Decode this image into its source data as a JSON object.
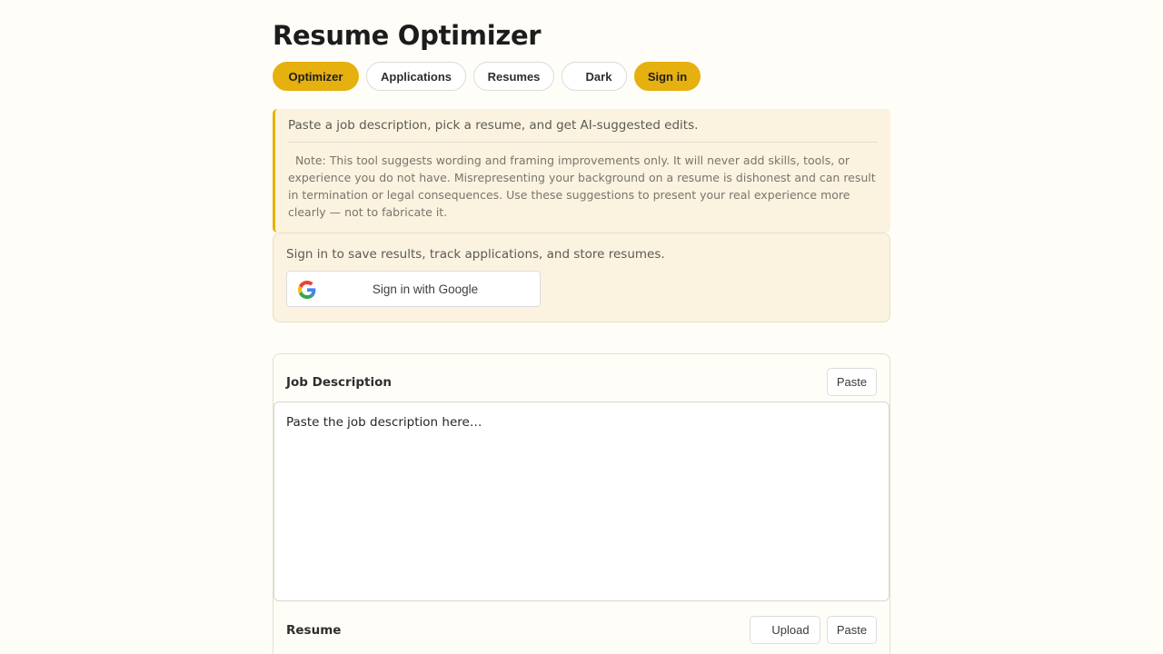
{
  "page": {
    "title": "Resume Optimizer"
  },
  "nav": {
    "optimizer": "Optimizer",
    "applications": "Applications",
    "resumes": "Resumes",
    "dark": "Dark",
    "sign_in": "Sign in"
  },
  "notice": {
    "intro": "Paste a job description, pick a resume, and get AI-suggested edits.",
    "warning": "  Note: This tool suggests wording and framing improvements only. It will never add skills, tools, or experience you do not have. Misrepresenting your background on a resume is dishonest and can result in termination or legal consequences. Use these suggestions to present your real experience more clearly — not to fabricate it."
  },
  "signin": {
    "text": "Sign in to save results, track applications, and store resumes.",
    "google_button": "Sign in with Google"
  },
  "job_description": {
    "label": "Job Description",
    "paste_button": "Paste",
    "placeholder": "Paste the job description here…",
    "value": ""
  },
  "resume": {
    "label": "Resume",
    "upload_button": "Upload",
    "paste_button": "Paste"
  },
  "colors": {
    "accent": "#e6b00f",
    "background": "#fffdf8",
    "notice_background": "#fbf3e0"
  },
  "icons": {
    "google": "google-g-icon"
  }
}
